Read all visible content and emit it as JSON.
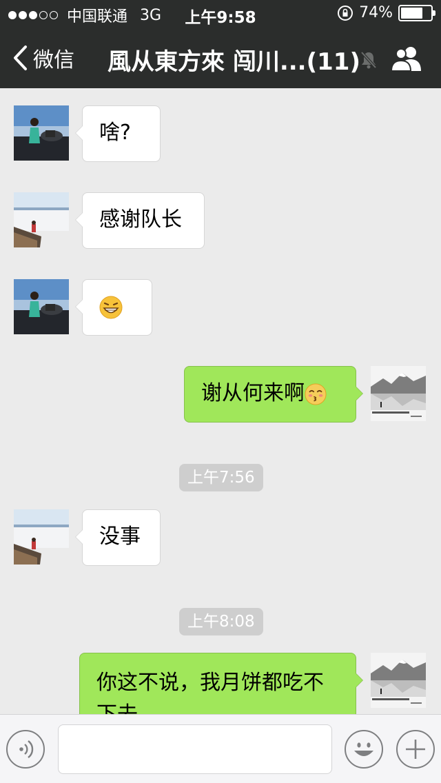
{
  "status_bar": {
    "carrier": "中国联通",
    "network": "3G",
    "time": "上午9:58",
    "battery": "74%",
    "battery_level": 0.74
  },
  "nav": {
    "back_label": "微信",
    "title": "風从東方來 闯川...(11)"
  },
  "messages": [
    {
      "side": "in",
      "avatar": "woman-by-car-avatar",
      "text": "啥?"
    },
    {
      "side": "in",
      "avatar": "person-at-lake-avatar",
      "text": "感谢队长"
    },
    {
      "side": "in",
      "avatar": "woman-by-car-avatar",
      "text": "",
      "emoji": "grinning-face-emoji"
    },
    {
      "side": "out",
      "avatar": "mountain-lake-avatar",
      "text": "谢从何来啊",
      "emoji": "kissing-face-emoji"
    },
    {
      "type": "time",
      "text": "上午7:56"
    },
    {
      "side": "in",
      "avatar": "person-at-lake-avatar",
      "text": "没事"
    },
    {
      "type": "time",
      "text": "上午8:08"
    },
    {
      "side": "out",
      "avatar": "mountain-lake-avatar",
      "text": "你这不说，我月饼都吃不下去"
    }
  ],
  "colors": {
    "header_bg": "#2b2d2c",
    "chat_bg": "#ebebeb",
    "outgoing_bubble": "#a0e75a",
    "incoming_bubble": "#ffffff",
    "timestamp_bg": "#cecece"
  },
  "input_bar": {
    "voice_icon": "voice-icon",
    "emoji_icon": "emoji-icon",
    "plus_icon": "plus-icon",
    "text_value": ""
  }
}
